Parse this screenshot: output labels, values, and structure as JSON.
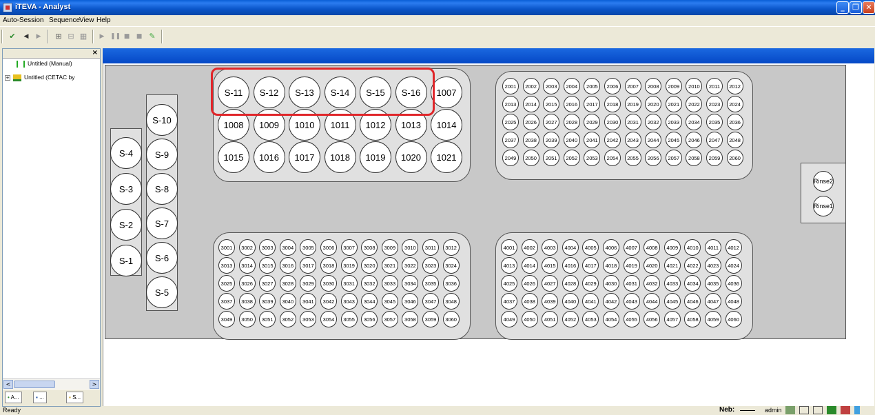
{
  "window": {
    "title": "iTEVA - Analyst"
  },
  "menu": [
    "Auto-Session",
    "Sequence",
    "View",
    "Help"
  ],
  "toolbar": {
    "icons": [
      "save-icon",
      "back-arrow-icon",
      "forward-arrow-icon",
      "add-sample-icon",
      "remove-sample-icon",
      "table-icon",
      "play-icon",
      "pause-icon",
      "stop-icon",
      "stop-all-icon",
      "edit-icon"
    ]
  },
  "tree": {
    "items": [
      {
        "label": "Untitled (Manual)",
        "icon": "manual-session-icon"
      },
      {
        "label": "Untitled (CETAC by",
        "icon": "autosampler-session-icon"
      }
    ],
    "close": "×"
  },
  "panel_tabs": [
    {
      "label": "A...",
      "icon": "analyst-icon"
    },
    {
      "label": "...",
      "icon": "sequence-icon"
    },
    {
      "label": "S...",
      "icon": "settings-icon"
    }
  ],
  "scroll": {
    "left": "<",
    "right": ">"
  },
  "standards": {
    "left": [
      "S-4",
      "S-3",
      "S-2",
      "S-1"
    ],
    "right": [
      "S-10",
      "S-9",
      "S-8",
      "S-7",
      "S-6",
      "S-5"
    ]
  },
  "top_rack": {
    "rows": [
      [
        "S-11",
        "S-12",
        "S-13",
        "S-14",
        "S-15",
        "S-16",
        "1007"
      ],
      [
        "1008",
        "1009",
        "1010",
        "1011",
        "1012",
        "1013",
        "1014"
      ],
      [
        "1015",
        "1016",
        "1017",
        "1018",
        "1019",
        "1020",
        "1021"
      ]
    ]
  },
  "rack_2000": {
    "start": 2001,
    "rows": 5,
    "cols": 12
  },
  "rack_3000": {
    "start": 3001,
    "rows": 5,
    "cols": 12
  },
  "rack_4000": {
    "start": 4001,
    "rows": 5,
    "cols": 12
  },
  "rinse": [
    "Rinse2",
    "Rinse1"
  ],
  "status": {
    "text": "Ready",
    "neb_label": "Neb:",
    "user": "admin"
  },
  "colors": {
    "highlight": "#e0262a",
    "title_bar": "#0a55c9"
  }
}
